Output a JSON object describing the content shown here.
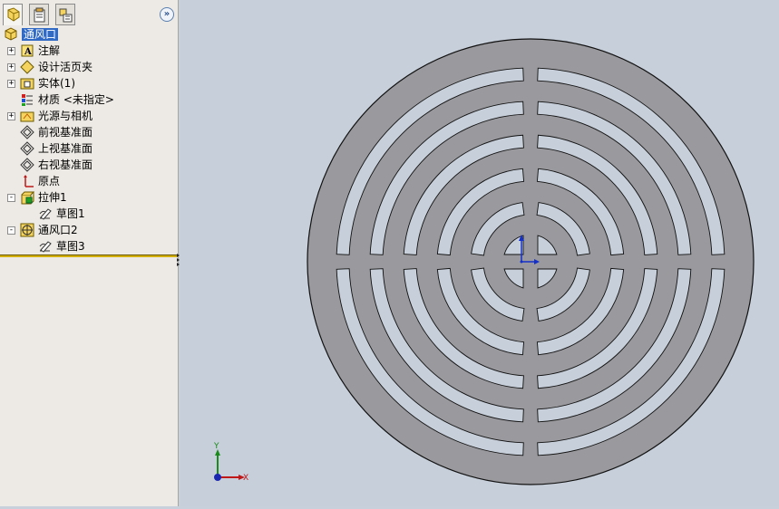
{
  "feature_manager": {
    "tabs": [
      {
        "name": "FeatureManager",
        "icon": "feature-tree-icon"
      },
      {
        "name": "PropertyManager",
        "icon": "property-manager-icon"
      },
      {
        "name": "ConfigurationManager",
        "icon": "configuration-manager-icon"
      }
    ],
    "collapse_label": "»",
    "root": {
      "label": "通风口",
      "icon": "part-icon"
    },
    "items": [
      {
        "label": "注解",
        "icon": "annotations-icon",
        "expander": "+"
      },
      {
        "label": "设计活页夹",
        "icon": "design-binder-icon",
        "expander": "+"
      },
      {
        "label": "实体(1)",
        "icon": "solid-bodies-icon",
        "expander": "+"
      },
      {
        "label": "材质 <未指定>",
        "icon": "material-icon",
        "expander": ""
      },
      {
        "label": "光源与相机",
        "icon": "lights-cameras-icon",
        "expander": "+"
      },
      {
        "label": "前视基准面",
        "icon": "plane-icon",
        "expander": ""
      },
      {
        "label": "上视基准面",
        "icon": "plane-icon",
        "expander": ""
      },
      {
        "label": "右视基准面",
        "icon": "plane-icon",
        "expander": ""
      },
      {
        "label": "原点",
        "icon": "origin-icon",
        "expander": ""
      },
      {
        "label": "拉伸1",
        "icon": "extrude-icon",
        "expander": "−"
      },
      {
        "label": "草图1",
        "icon": "sketch-icon",
        "expander": ""
      },
      {
        "label": "通风口2",
        "icon": "vent-icon",
        "expander": "−"
      },
      {
        "label": "草图3",
        "icon": "sketch-icon",
        "expander": ""
      }
    ]
  },
  "viewport": {
    "triad": {
      "x_label": "X",
      "y_label": "Y"
    },
    "colors": {
      "background": "#c7cfdb",
      "part_face": "#9a9a9e",
      "part_edge": "#111111"
    }
  }
}
